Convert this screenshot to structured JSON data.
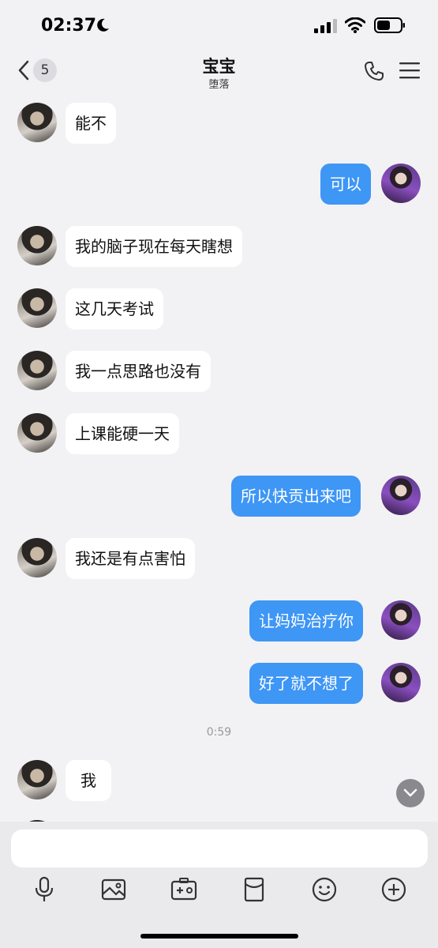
{
  "status_bar": {
    "time": "02:37"
  },
  "nav": {
    "back_count": "5",
    "title": "宝宝",
    "subtitle": "堕落"
  },
  "messages": {
    "m1": "能不",
    "m2": "可以",
    "m3": "我的脑子现在每天瞎想",
    "m4": "这几天考试",
    "m5": "我一点思路也没有",
    "m6": "上课能硬一天",
    "m7": "所以快贡出来吧",
    "m8": "我还是有点害怕",
    "m9": "让妈妈治疗你",
    "m10": "好了就不想了",
    "time_separator": "0:59",
    "m11": "我"
  },
  "input": {
    "value": ""
  },
  "toolbar": [
    "microphone-icon",
    "image-icon",
    "camera-icon",
    "red-packet-icon",
    "emoji-icon",
    "plus-icon"
  ],
  "colors": {
    "outgoing_bubble": "#3e96f5",
    "incoming_bubble": "#ffffff",
    "background": "#f2f2f4"
  }
}
